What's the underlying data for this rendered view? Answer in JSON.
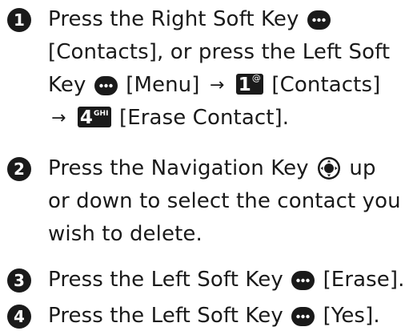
{
  "steps": [
    {
      "number": "1",
      "parts": {
        "a": "Press the Right Soft Key",
        "b": "[Contacts], or press the Left Soft",
        "c": "Key",
        "d": "[Menu]",
        "e": "[Contacts]",
        "f": "[Erase Contact]."
      },
      "key_1": {
        "digit": "1",
        "sub": "@"
      },
      "key_4": {
        "digit": "4",
        "sub": "GHI"
      }
    },
    {
      "number": "2",
      "parts": {
        "a": "Press the Navigation Key",
        "b": "up",
        "c": "or down to select the contact you",
        "d": "wish to delete."
      }
    },
    {
      "number": "3",
      "parts": {
        "a": "Press the Left Soft Key",
        "b": "[Erase]."
      }
    },
    {
      "number": "4",
      "parts": {
        "a": "Press the Left Soft Key",
        "b": "[Yes]."
      }
    }
  ],
  "arrow_glyph": "→",
  "icons": {
    "soft_key": "soft-key-icon",
    "nav_key": "navigation-key-icon",
    "key_1": "key-1-icon",
    "key_4": "key-4-icon"
  },
  "colors": {
    "text": "#1a1a1a",
    "icon_fill": "#1a1a1a",
    "background": "#ffffff"
  }
}
